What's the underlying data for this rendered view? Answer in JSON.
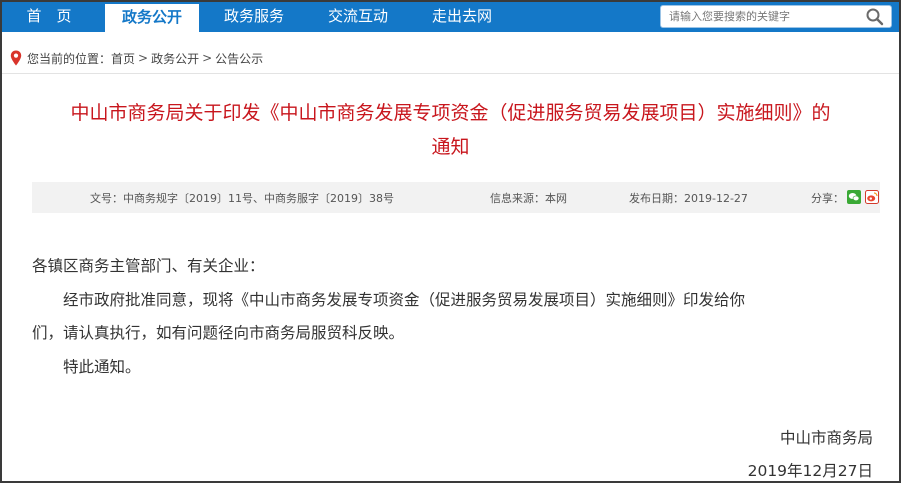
{
  "nav": {
    "items": [
      {
        "label": "首　页"
      },
      {
        "label": "政务公开"
      },
      {
        "label": "政务服务"
      },
      {
        "label": "交流互动"
      },
      {
        "label": "走出去网"
      }
    ]
  },
  "search": {
    "placeholder": "请输入您要搜索的关键字"
  },
  "breadcrumb": {
    "prefix": "您当前的位置：",
    "items": [
      "首页",
      "政务公开",
      "公告公示"
    ],
    "separator": ">"
  },
  "article": {
    "title_line1": "中山市商务局关于印发《中山市商务发展专项资金（促进服务贸易发展项目）实施细则》的",
    "title_line2": "通知",
    "meta": {
      "doc_no": "文号：中商务规字〔2019〕11号、中商务服字〔2019〕38号",
      "source": "信息来源：本网",
      "date": "发布日期：2019-12-27",
      "share_label": "分享："
    },
    "salutation": "各镇区商务主管部门、有关企业：",
    "paragraph1_line1": "经市政府批准同意，现将《中山市商务发展专项资金（促进服务贸易发展项目）实施细则》印发给你",
    "paragraph1_line2": "们，请认真执行，如有问题径向市商务局服贸科反映。",
    "paragraph2": "特此通知。",
    "signature_org": "中山市商务局",
    "signature_date": "2019年12月27日"
  },
  "colors": {
    "nav_bg": "#1478c8",
    "title_red": "#c8161d",
    "meta_bg": "#f2f2f2"
  },
  "icons": {
    "search": "search-icon",
    "location": "location-pin-icon",
    "share_wechat": "wechat-icon",
    "share_weibo": "weibo-icon"
  }
}
